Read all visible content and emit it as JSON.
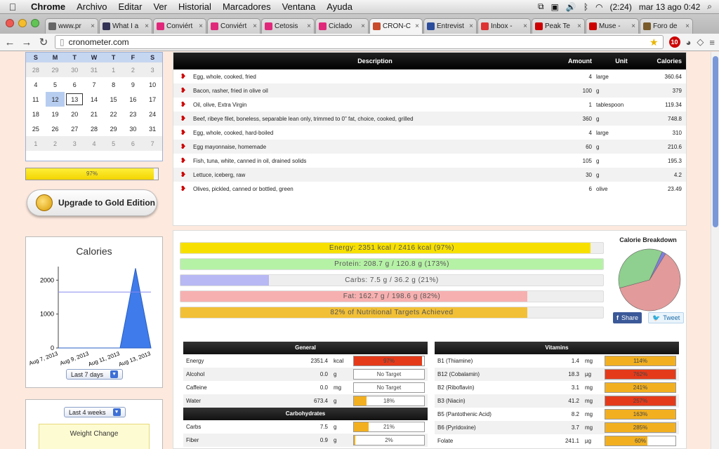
{
  "menubar": {
    "app": "Chrome",
    "items": [
      "Archivo",
      "Editar",
      "Ver",
      "Historial",
      "Marcadores",
      "Ventana",
      "Ayuda"
    ],
    "battery": "(2:24)",
    "clock": "mar 13 ago  0:42"
  },
  "tabs": [
    {
      "label": "www.pr",
      "color": "#666"
    },
    {
      "label": "What I a",
      "color": "#335"
    },
    {
      "label": "Conviért",
      "color": "#e0287a"
    },
    {
      "label": "Conviért",
      "color": "#e0287a"
    },
    {
      "label": "Cetosis",
      "color": "#e0287a"
    },
    {
      "label": "Ciclado",
      "color": "#e0287a"
    },
    {
      "label": "CRON-C",
      "color": "#c84b2b",
      "active": true
    },
    {
      "label": "Entrevist",
      "color": "#2b4c9b"
    },
    {
      "label": "Inbox -",
      "color": "#d33"
    },
    {
      "label": "Peak Te",
      "color": "#c00"
    },
    {
      "label": "Muse - ",
      "color": "#c00"
    },
    {
      "label": "Foro de",
      "color": "#7a5b2b"
    }
  ],
  "address": {
    "url": "cronometer.com",
    "badge": "10"
  },
  "calendar": {
    "weekdays": [
      "S",
      "M",
      "T",
      "W",
      "T",
      "F",
      "S"
    ],
    "weeks": [
      [
        "28",
        "29",
        "30",
        "31",
        "1",
        "2",
        "3"
      ],
      [
        "4",
        "5",
        "6",
        "7",
        "8",
        "9",
        "10"
      ],
      [
        "11",
        "12",
        "13",
        "14",
        "15",
        "16",
        "17"
      ],
      [
        "18",
        "19",
        "20",
        "21",
        "22",
        "23",
        "24"
      ],
      [
        "25",
        "26",
        "27",
        "28",
        "29",
        "30",
        "31"
      ],
      [
        "1",
        "2",
        "3",
        "4",
        "5",
        "6",
        "7"
      ]
    ]
  },
  "energy_progress": {
    "label": "97%",
    "value": 0.97
  },
  "upgrade_button": "Upgrade to Gold Edition",
  "calories_chart": {
    "title": "Calories",
    "range_select": "Last 7 days"
  },
  "chart_data": {
    "type": "area",
    "title": "Calories",
    "x": [
      "Aug 7, 2013",
      "Aug 8, 2013",
      "Aug 9, 2013",
      "Aug 10, 2013",
      "Aug 11, 2013",
      "Aug 12, 2013",
      "Aug 13, 2013"
    ],
    "x_ticks": [
      "Aug 7, 2013",
      "Aug 9, 2013",
      "Aug 11, 2013",
      "Aug 13, 2013"
    ],
    "series": [
      {
        "values": [
          0,
          0,
          0,
          0,
          0,
          2351,
          0
        ]
      }
    ],
    "target_line": 1650,
    "yticks": [
      0,
      1000,
      2000
    ],
    "ylim": [
      0,
      2400
    ]
  },
  "weight": {
    "range_select": "Last 4 weeks",
    "label": "Weight Change"
  },
  "food_table": {
    "headers": {
      "description": "Description",
      "amount": "Amount",
      "unit": "Unit",
      "calories": "Calories"
    },
    "rows": [
      {
        "desc": "Egg, whole, cooked, fried",
        "amount": "4",
        "unit": "large",
        "cal": "360.64"
      },
      {
        "desc": "Bacon, rasher, fried in olive oil",
        "amount": "100",
        "unit": "g",
        "cal": "379"
      },
      {
        "desc": "Oil, olive, Extra Virgin",
        "amount": "1",
        "unit": "tablespoon",
        "cal": "119.34"
      },
      {
        "desc": "Beef, ribeye filet, boneless, separable lean only, trimmed to 0\" fat, choice, cooked, grilled",
        "amount": "360",
        "unit": "g",
        "cal": "748.8"
      },
      {
        "desc": "Egg, whole, cooked, hard-boiled",
        "amount": "4",
        "unit": "large",
        "cal": "310"
      },
      {
        "desc": "Egg mayonnaise, homemade",
        "amount": "60",
        "unit": "g",
        "cal": "210.6"
      },
      {
        "desc": "Fish, tuna, white, canned in oil, drained solids",
        "amount": "105",
        "unit": "g",
        "cal": "195.3"
      },
      {
        "desc": "Lettuce, iceberg, raw",
        "amount": "30",
        "unit": "g",
        "cal": "4.2"
      },
      {
        "desc": "Olives, pickled, canned or bottled, green",
        "amount": "6",
        "unit": "olive",
        "cal": "23.49"
      }
    ]
  },
  "summary_bars": [
    {
      "label": "Energy: 2351 kcal / 2416 kcal (97%)",
      "value": 0.97,
      "color": "#f7e000"
    },
    {
      "label": "Protein: 208.7 g / 120.8 g (173%)",
      "value": 1.0,
      "color": "#b6f2a6"
    },
    {
      "label": "Carbs: 7.5 g / 36.2 g (21%)",
      "value": 0.21,
      "color": "#b8b8f4"
    },
    {
      "label": "Fat: 162.7 g / 198.6 g (82%)",
      "value": 0.82,
      "color": "#f7b0b0"
    },
    {
      "label": "82% of Nutritional Targets Achieved",
      "value": 0.82,
      "color": "#f2c036"
    }
  ],
  "calorie_breakdown": {
    "title": "Calorie Breakdown",
    "slices": [
      {
        "value": 0.62,
        "color": "#e39a9a"
      },
      {
        "value": 0.36,
        "color": "#8fcf8f"
      },
      {
        "value": 0.02,
        "color": "#7f7fe0"
      }
    ],
    "share_fb": "Share",
    "share_tw": "Tweet"
  },
  "general_table": {
    "title": "General",
    "rows": [
      {
        "name": "Energy",
        "amt": "2351.4",
        "unit": "kcal",
        "pct": "97%",
        "value": 0.97,
        "color": "#e53a1a"
      },
      {
        "name": "Alcohol",
        "amt": "0.0",
        "unit": "g",
        "pct": "No Target",
        "value": 0,
        "color": "#fff"
      },
      {
        "name": "Caffeine",
        "amt": "0.0",
        "unit": "mg",
        "pct": "No Target",
        "value": 0,
        "color": "#fff"
      },
      {
        "name": "Water",
        "amt": "673.4",
        "unit": "g",
        "pct": "18%",
        "value": 0.18,
        "color": "#f2b020"
      }
    ]
  },
  "carbs_table": {
    "title": "Carbohydrates",
    "rows": [
      {
        "name": "Carbs",
        "amt": "7.5",
        "unit": "g",
        "pct": "21%",
        "value": 0.21,
        "color": "#f2b020"
      },
      {
        "name": "Fiber",
        "amt": "0.9",
        "unit": "g",
        "pct": "2%",
        "value": 0.02,
        "color": "#f2b020"
      }
    ]
  },
  "vitamins_table": {
    "title": "Vitamins",
    "rows": [
      {
        "name": "B1 (Thiamine)",
        "amt": "1.4",
        "unit": "mg",
        "pct": "114%",
        "value": 1,
        "color": "#f2b020"
      },
      {
        "name": "B12 (Cobalamin)",
        "amt": "18.3",
        "unit": "µg",
        "pct": "762%",
        "value": 1,
        "color": "#e53a1a"
      },
      {
        "name": "B2 (Riboflavin)",
        "amt": "3.1",
        "unit": "mg",
        "pct": "241%",
        "value": 1,
        "color": "#f2b020"
      },
      {
        "name": "B3 (Niacin)",
        "amt": "41.2",
        "unit": "mg",
        "pct": "257%",
        "value": 1,
        "color": "#e53a1a"
      },
      {
        "name": "B5 (Pantothenic Acid)",
        "amt": "8.2",
        "unit": "mg",
        "pct": "163%",
        "value": 1,
        "color": "#f2b020"
      },
      {
        "name": "B6 (Pyridoxine)",
        "amt": "3.7",
        "unit": "mg",
        "pct": "285%",
        "value": 1,
        "color": "#f2b020"
      },
      {
        "name": "Folate",
        "amt": "241.1",
        "unit": "µg",
        "pct": "60%",
        "value": 0.6,
        "color": "#f2b020"
      }
    ]
  }
}
